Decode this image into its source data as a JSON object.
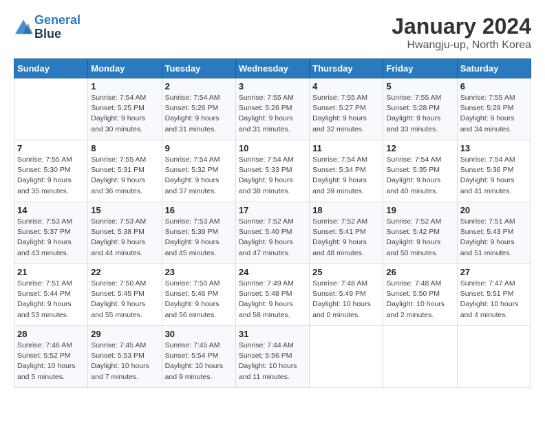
{
  "header": {
    "logo_line1": "General",
    "logo_line2": "Blue",
    "month_year": "January 2024",
    "location": "Hwangju-up, North Korea"
  },
  "weekdays": [
    "Sunday",
    "Monday",
    "Tuesday",
    "Wednesday",
    "Thursday",
    "Friday",
    "Saturday"
  ],
  "weeks": [
    [
      {
        "day": "",
        "info": ""
      },
      {
        "day": "1",
        "info": "Sunrise: 7:54 AM\nSunset: 5:25 PM\nDaylight: 9 hours\nand 30 minutes."
      },
      {
        "day": "2",
        "info": "Sunrise: 7:54 AM\nSunset: 5:26 PM\nDaylight: 9 hours\nand 31 minutes."
      },
      {
        "day": "3",
        "info": "Sunrise: 7:55 AM\nSunset: 5:26 PM\nDaylight: 9 hours\nand 31 minutes."
      },
      {
        "day": "4",
        "info": "Sunrise: 7:55 AM\nSunset: 5:27 PM\nDaylight: 9 hours\nand 32 minutes."
      },
      {
        "day": "5",
        "info": "Sunrise: 7:55 AM\nSunset: 5:28 PM\nDaylight: 9 hours\nand 33 minutes."
      },
      {
        "day": "6",
        "info": "Sunrise: 7:55 AM\nSunset: 5:29 PM\nDaylight: 9 hours\nand 34 minutes."
      }
    ],
    [
      {
        "day": "7",
        "info": "Sunrise: 7:55 AM\nSunset: 5:30 PM\nDaylight: 9 hours\nand 35 minutes."
      },
      {
        "day": "8",
        "info": "Sunrise: 7:55 AM\nSunset: 5:31 PM\nDaylight: 9 hours\nand 36 minutes."
      },
      {
        "day": "9",
        "info": "Sunrise: 7:54 AM\nSunset: 5:32 PM\nDaylight: 9 hours\nand 37 minutes."
      },
      {
        "day": "10",
        "info": "Sunrise: 7:54 AM\nSunset: 5:33 PM\nDaylight: 9 hours\nand 38 minutes."
      },
      {
        "day": "11",
        "info": "Sunrise: 7:54 AM\nSunset: 5:34 PM\nDaylight: 9 hours\nand 39 minutes."
      },
      {
        "day": "12",
        "info": "Sunrise: 7:54 AM\nSunset: 5:35 PM\nDaylight: 9 hours\nand 40 minutes."
      },
      {
        "day": "13",
        "info": "Sunrise: 7:54 AM\nSunset: 5:36 PM\nDaylight: 9 hours\nand 41 minutes."
      }
    ],
    [
      {
        "day": "14",
        "info": "Sunrise: 7:53 AM\nSunset: 5:37 PM\nDaylight: 9 hours\nand 43 minutes."
      },
      {
        "day": "15",
        "info": "Sunrise: 7:53 AM\nSunset: 5:38 PM\nDaylight: 9 hours\nand 44 minutes."
      },
      {
        "day": "16",
        "info": "Sunrise: 7:53 AM\nSunset: 5:39 PM\nDaylight: 9 hours\nand 45 minutes."
      },
      {
        "day": "17",
        "info": "Sunrise: 7:52 AM\nSunset: 5:40 PM\nDaylight: 9 hours\nand 47 minutes."
      },
      {
        "day": "18",
        "info": "Sunrise: 7:52 AM\nSunset: 5:41 PM\nDaylight: 9 hours\nand 48 minutes."
      },
      {
        "day": "19",
        "info": "Sunrise: 7:52 AM\nSunset: 5:42 PM\nDaylight: 9 hours\nand 50 minutes."
      },
      {
        "day": "20",
        "info": "Sunrise: 7:51 AM\nSunset: 5:43 PM\nDaylight: 9 hours\nand 51 minutes."
      }
    ],
    [
      {
        "day": "21",
        "info": "Sunrise: 7:51 AM\nSunset: 5:44 PM\nDaylight: 9 hours\nand 53 minutes."
      },
      {
        "day": "22",
        "info": "Sunrise: 7:50 AM\nSunset: 5:45 PM\nDaylight: 9 hours\nand 55 minutes."
      },
      {
        "day": "23",
        "info": "Sunrise: 7:50 AM\nSunset: 5:46 PM\nDaylight: 9 hours\nand 56 minutes."
      },
      {
        "day": "24",
        "info": "Sunrise: 7:49 AM\nSunset: 5:48 PM\nDaylight: 9 hours\nand 58 minutes."
      },
      {
        "day": "25",
        "info": "Sunrise: 7:48 AM\nSunset: 5:49 PM\nDaylight: 10 hours\nand 0 minutes."
      },
      {
        "day": "26",
        "info": "Sunrise: 7:48 AM\nSunset: 5:50 PM\nDaylight: 10 hours\nand 2 minutes."
      },
      {
        "day": "27",
        "info": "Sunrise: 7:47 AM\nSunset: 5:51 PM\nDaylight: 10 hours\nand 4 minutes."
      }
    ],
    [
      {
        "day": "28",
        "info": "Sunrise: 7:46 AM\nSunset: 5:52 PM\nDaylight: 10 hours\nand 5 minutes."
      },
      {
        "day": "29",
        "info": "Sunrise: 7:45 AM\nSunset: 5:53 PM\nDaylight: 10 hours\nand 7 minutes."
      },
      {
        "day": "30",
        "info": "Sunrise: 7:45 AM\nSunset: 5:54 PM\nDaylight: 10 hours\nand 9 minutes."
      },
      {
        "day": "31",
        "info": "Sunrise: 7:44 AM\nSunset: 5:56 PM\nDaylight: 10 hours\nand 11 minutes."
      },
      {
        "day": "",
        "info": ""
      },
      {
        "day": "",
        "info": ""
      },
      {
        "day": "",
        "info": ""
      }
    ]
  ]
}
